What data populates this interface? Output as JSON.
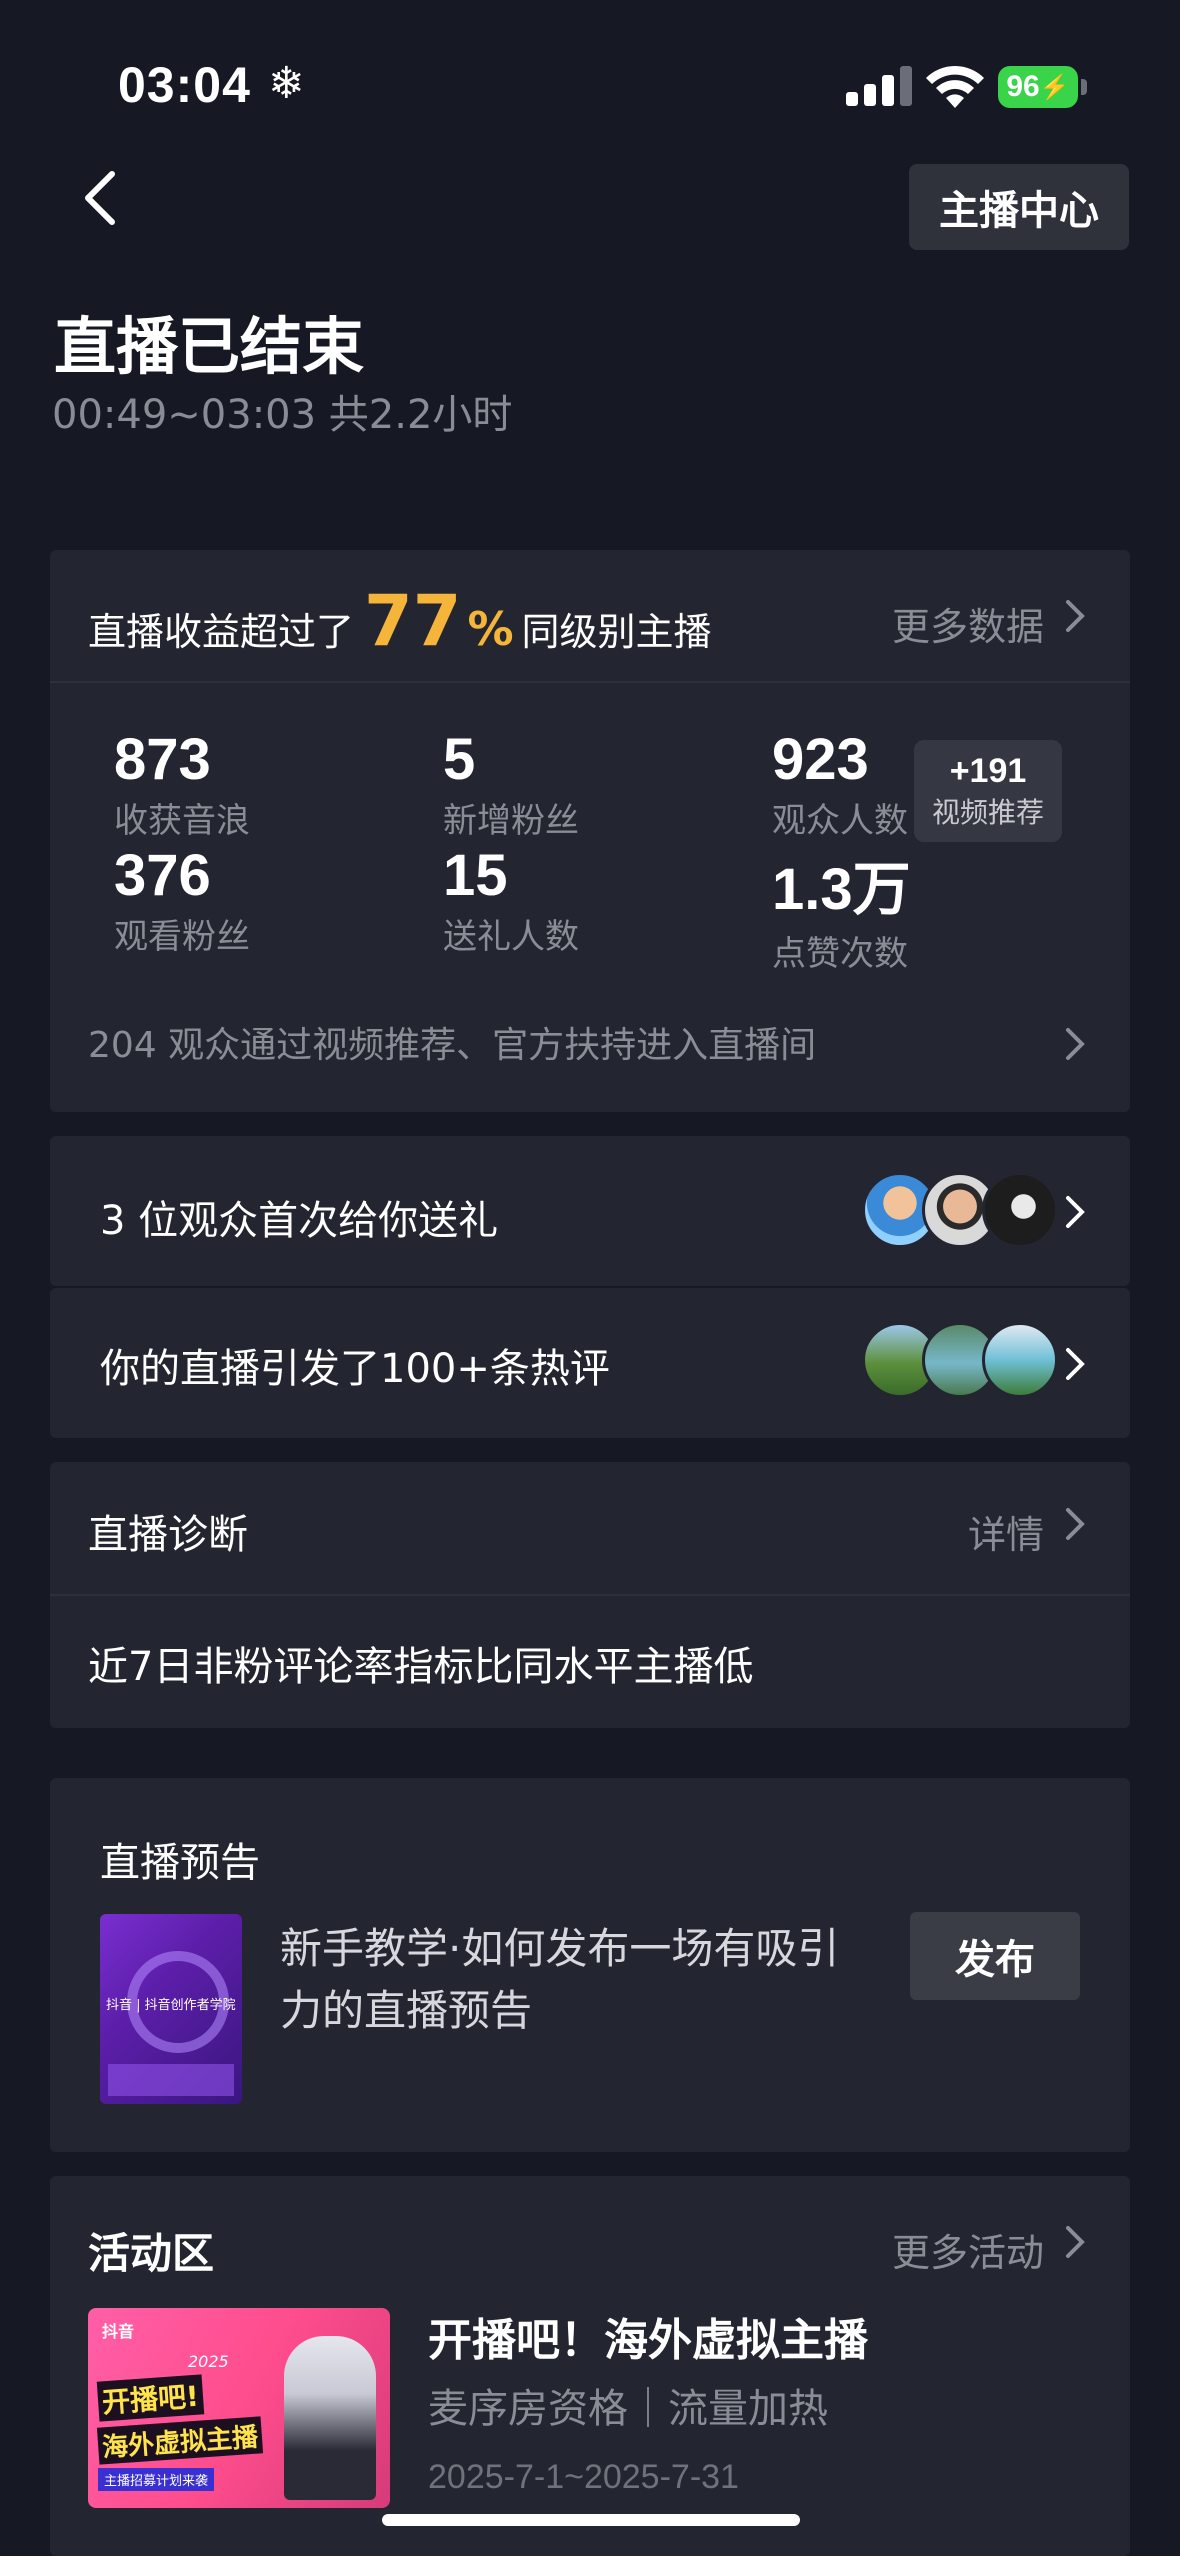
{
  "status_bar": {
    "time": "03:04",
    "snow_glyph": "❄",
    "battery": "96"
  },
  "header": {
    "back_icon": "chevron-left-icon",
    "anchor_center_label": "主播中心",
    "title": "直播已结束",
    "subtitle": "00:49~03:03 共2.2小时"
  },
  "revenue_card": {
    "prefix": "直播收益超过了",
    "percent": "77",
    "percent_sign": "%",
    "suffix": "同级别主播",
    "more_label": "更多数据",
    "stats": [
      {
        "value": "873",
        "label": "收获音浪"
      },
      {
        "value": "5",
        "label": "新增粉丝"
      },
      {
        "value": "923",
        "label": "观众人数"
      },
      {
        "value": "376",
        "label": "观看粉丝"
      },
      {
        "value": "15",
        "label": "送礼人数"
      },
      {
        "value": "1.3万",
        "label": "点赞次数"
      }
    ],
    "boost": {
      "value": "+191",
      "label": "视频推荐"
    },
    "entry_note": "204 观众通过视频推荐、官方扶持进入直播间"
  },
  "gift_row": {
    "label": "3 位观众首次给你送礼"
  },
  "comment_row": {
    "label": "你的直播引发了100+条热评"
  },
  "diagnosis": {
    "title": "直播诊断",
    "detail_label": "详情",
    "text": "近7日非粉评论率指标比同水平主播低"
  },
  "preview": {
    "title": "直播预告",
    "thumb_caption": "抖音 | 抖音创作者学院",
    "description": "新手教学·如何发布一场有吸引力的直播预告",
    "publish_label": "发布"
  },
  "activity": {
    "title": "活动区",
    "more_label": "更多活动",
    "thumb_brand": "抖音",
    "thumb_year": "2025",
    "thumb_line1": "开播吧!",
    "thumb_line2": "海外虚拟主播",
    "thumb_tag": "主播招募计划来袭",
    "name": "开播吧！海外虚拟主播",
    "tags": "麦序房资格｜流量加热",
    "dates": "2025-7-1~2025-7-31"
  },
  "colors": {
    "background": "#161823",
    "card": "#232530",
    "accent_gold": "#f5b43a",
    "battery_green": "#3ad44a"
  }
}
